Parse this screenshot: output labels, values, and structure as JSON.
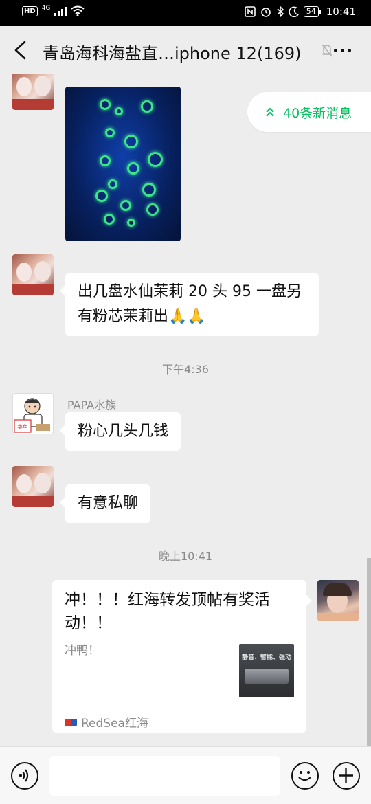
{
  "status_bar": {
    "hd": "HD",
    "network": "4G",
    "battery": "54",
    "time": "10:41"
  },
  "header": {
    "title": "青岛海科海盐直…iphone 12(169)"
  },
  "new_messages": {
    "label": "40条新消息"
  },
  "messages": {
    "msg1_text": "出几盘水仙茉莉 20 头 95 一盘另有粉芯茉莉出🙏🙏",
    "time1": "下午4:36",
    "msg2_sender": "PAPA水族",
    "msg2_text": "粉心几头几钱",
    "msg3_text": "有意私聊",
    "time2": "晚上10:41"
  },
  "link_card": {
    "title": "冲！！！红海转发顶帖有奖活动！！",
    "description": "冲鸭！",
    "thumb_text": "静音、智能、强动",
    "source": "RedSea红海"
  },
  "avatar_papa": {
    "sign": "卖鱼"
  },
  "input": {
    "placeholder": ""
  },
  "icons": {
    "back": "back-arrow-icon",
    "more": "more-dots-icon",
    "mute": "mute-bell-icon",
    "voice": "voice-icon",
    "emoji": "emoji-icon",
    "plus": "plus-icon"
  },
  "colors": {
    "accent_green": "#07c160",
    "chat_background": "#ededed"
  }
}
